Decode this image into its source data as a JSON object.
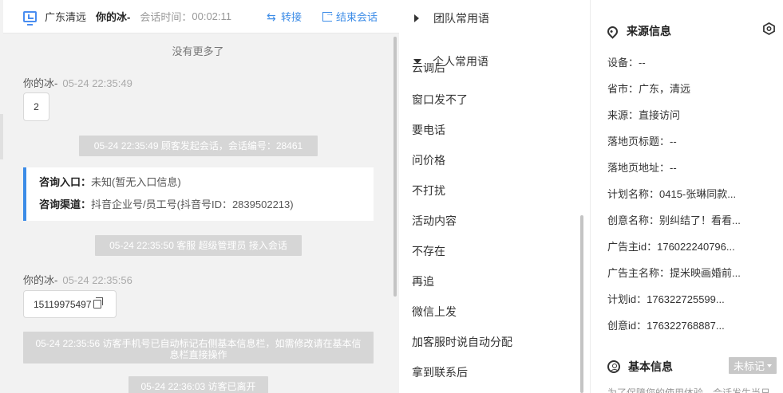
{
  "header": {
    "source": "广东清远",
    "visitor_name": "你的冰-",
    "session_time_label": "会话时间：",
    "session_time": "00:02:11",
    "transfer_label": "转接",
    "end_label": "结束会话"
  },
  "chat": {
    "no_more": "没有更多了",
    "messages": [
      {
        "sender": "你的冰-",
        "time": "05-24 22:35:49",
        "text": "2"
      },
      {
        "sender": "你的冰-",
        "time": "05-24 22:35:56",
        "text": "15119975497"
      }
    ],
    "system": [
      "05-24 22:35:49 顾客发起会话，会话编号：28461",
      "05-24 22:35:50 客服 超级管理员 接入会话",
      "05-24 22:35:56 访客手机号已自动标记右侧基本信息栏，如需修改请在基本信息栏直接操作",
      "05-24 22:36:03 访客已离开"
    ],
    "consult": {
      "entry_label": "咨询入口：",
      "entry_value": "未知(暂无入口信息)",
      "channel_label": "咨询渠道：",
      "channel_value": "抖音企业号/员工号(抖音号ID：2839502213)"
    }
  },
  "phrases": {
    "team_group": "团队常用语",
    "personal_group": "个人常用语",
    "cut_item": "云调后",
    "items": [
      "窗口发不了",
      "要电话",
      "问价格",
      "不打扰",
      "活动内容",
      "不存在",
      "再追",
      "微信上发",
      "加客服时说自动分配",
      "拿到联系后"
    ]
  },
  "sidebar": {
    "source_title": "来源信息",
    "fields": [
      "设备：--",
      "省市：广东，清远",
      "来源：直接访问",
      "落地页标题：--",
      "落地页地址：--",
      "计划名称：0415-张琳同款...",
      "创意名称：别纠结了！看看...",
      "广告主id：176022240796...",
      "广告主名称：提米映画婚前...",
      "计划id：176322725599...",
      "创意id：176322768887..."
    ],
    "basic_title": "基本信息",
    "tag_label": "未标记",
    "notice": "为了保障您的使用体验，会话发生当日"
  }
}
